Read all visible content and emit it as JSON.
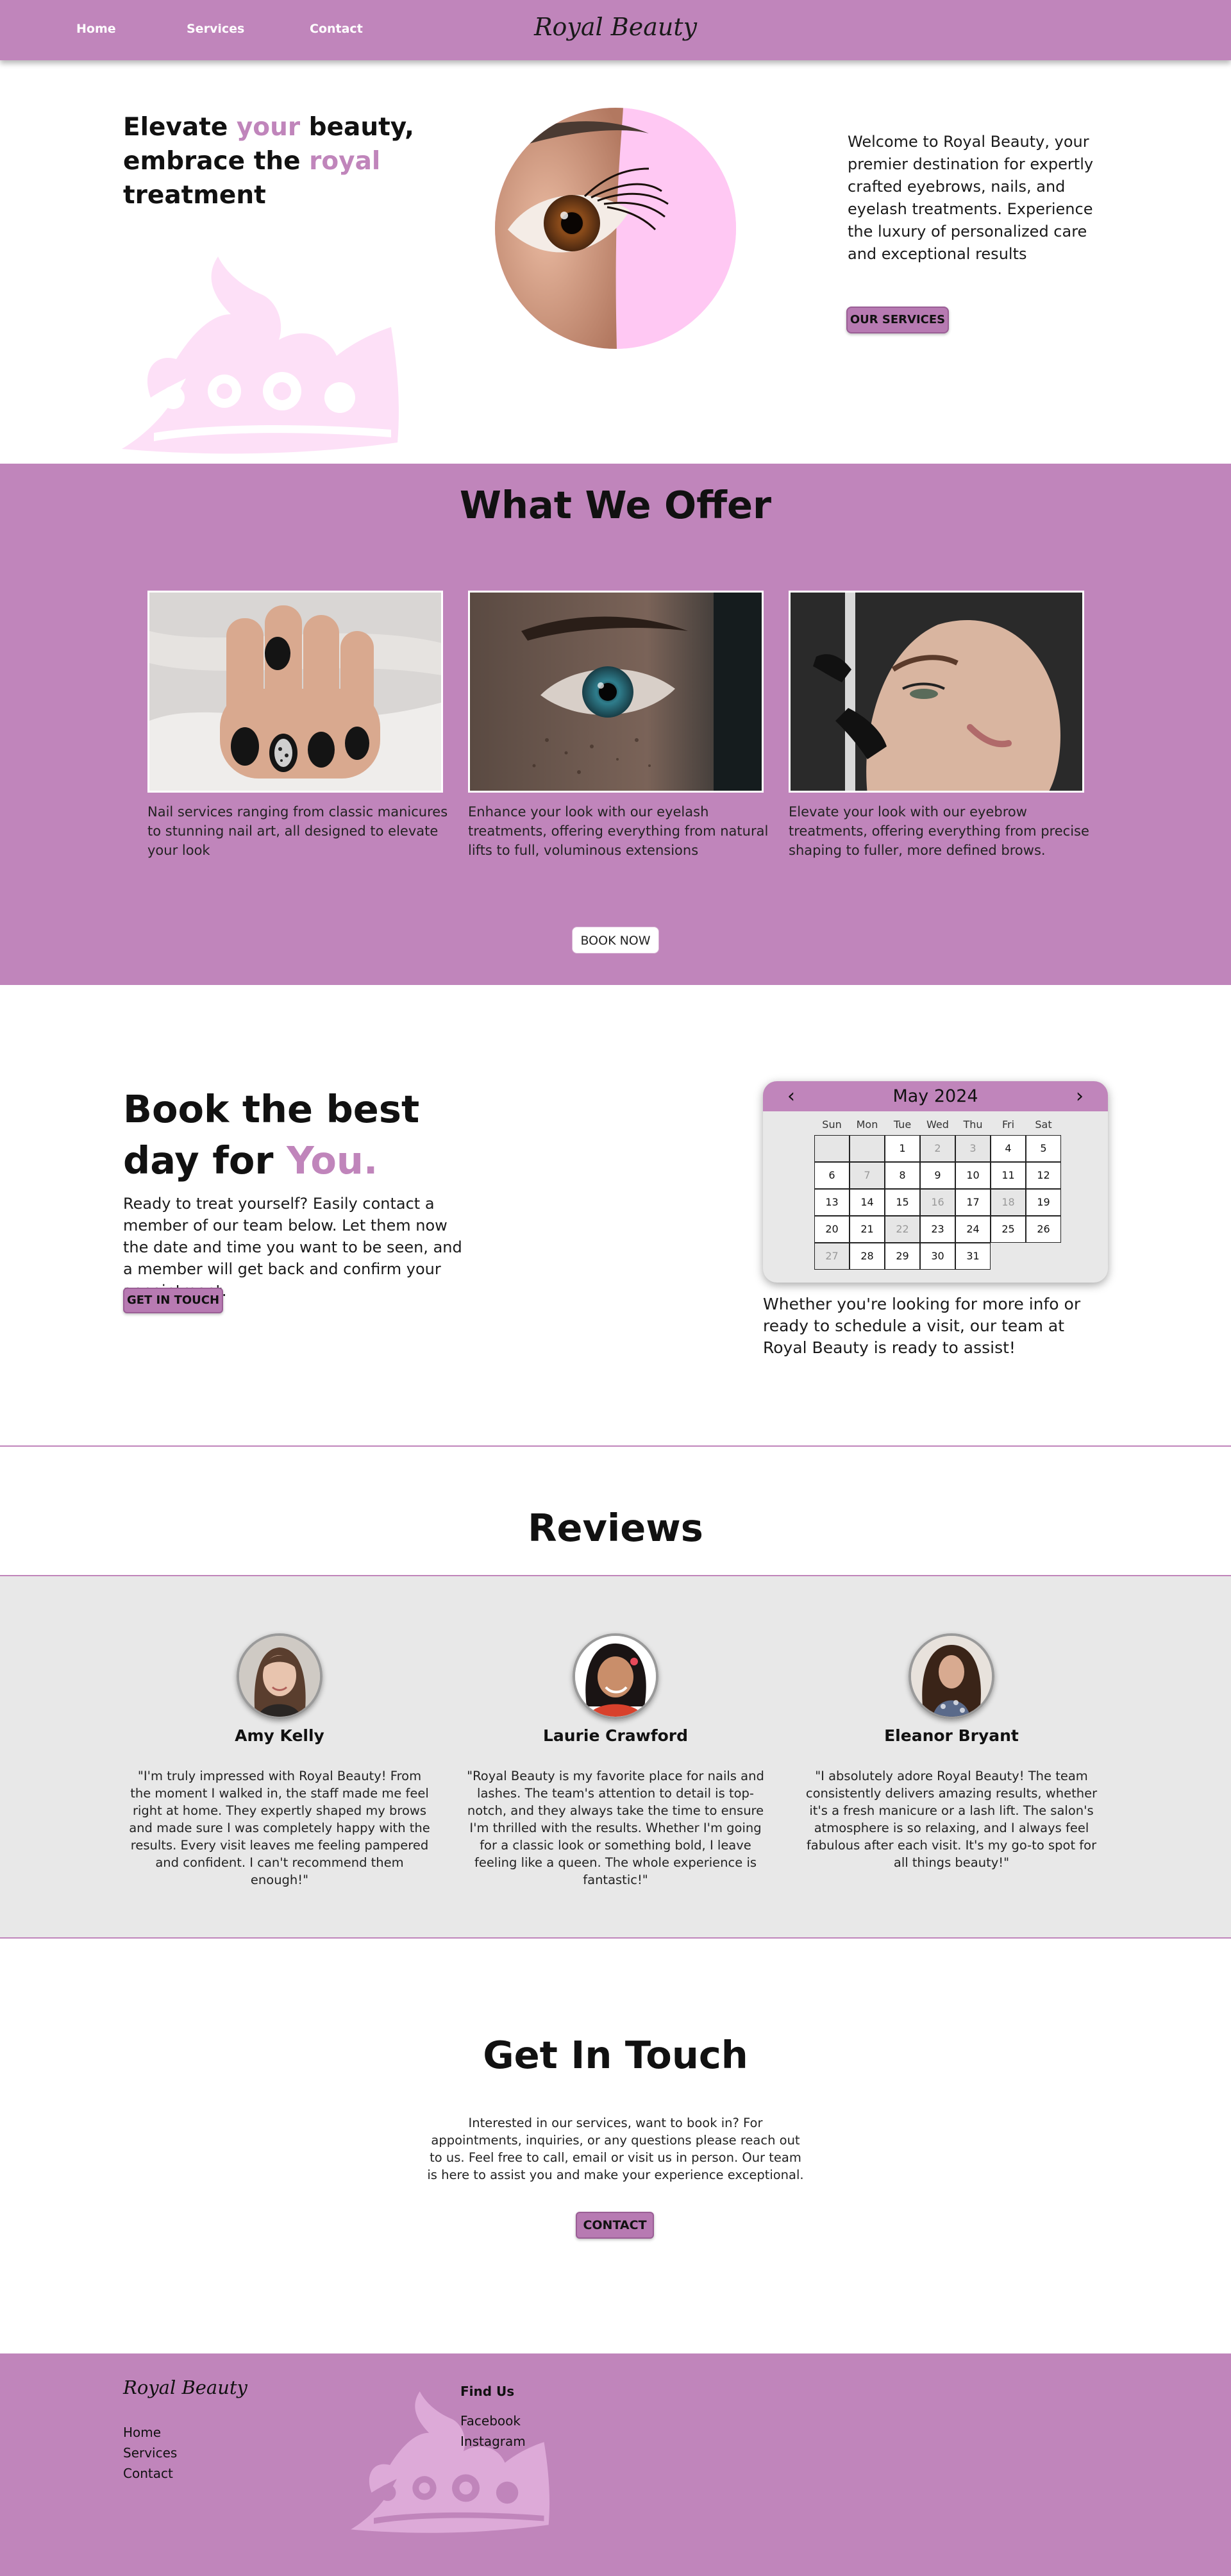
{
  "nav": {
    "links": [
      "Home",
      "Services",
      "Contact"
    ],
    "brand": "Royal Beauty"
  },
  "hero": {
    "title_parts": [
      "Elevate ",
      "your",
      " beauty, embrace the ",
      "royal",
      " treatment"
    ],
    "text": "Welcome to Royal Beauty, your premier destination for expertly crafted eyebrows, nails, and eyelash treatments. Experience the luxury of personalized care and exceptional results",
    "button": "OUR SERVICES"
  },
  "offer": {
    "title": "What We Offer",
    "cards": [
      {
        "text": "Nail services ranging from classic manicures to stunning nail art, all designed to elevate your look"
      },
      {
        "text": "Enhance your look with our eyelash treatments, offering everything from natural lifts to full, voluminous extensions"
      },
      {
        "text": "Elevate your look with our eyebrow treatments, offering everything from precise shaping to fuller, more defined brows."
      }
    ],
    "button": "BOOK NOW"
  },
  "booking": {
    "title_parts": [
      "Book the best day for ",
      "You."
    ],
    "text": "Ready to treat yourself? Easily contact a member of our team below. Let them now the date and time you want to be seen, and a member will get back and confirm your appointment.",
    "button": "GET IN TOUCH",
    "calendar": {
      "month": "May 2024",
      "prev": "‹",
      "next": "›",
      "weekdays": [
        "Sun",
        "Mon",
        "Tue",
        "Wed",
        "Thu",
        "Fri",
        "Sat"
      ],
      "weeks": [
        [
          "",
          "",
          "1",
          "2",
          "3",
          "4",
          "5"
        ],
        [
          "6",
          "7",
          "8",
          "9",
          "10",
          "11",
          "12"
        ],
        [
          "13",
          "14",
          "15",
          "16",
          "17",
          "18",
          "19"
        ],
        [
          "20",
          "21",
          "22",
          "23",
          "24",
          "25",
          "26"
        ],
        [
          "27",
          "28",
          "29",
          "30",
          "31"
        ]
      ],
      "unavailable": [
        "2",
        "3",
        "7",
        "16",
        "18",
        "22",
        "27"
      ]
    },
    "note": "Whether you're looking for more info or ready to schedule a visit, our team at Royal Beauty is ready to assist!"
  },
  "reviews": {
    "title": "Reviews",
    "items": [
      {
        "name": "Amy Kelly",
        "text": "\"I'm truly impressed with Royal Beauty! From the moment I walked in, the staff made me feel right at home. They expertly shaped my brows and made sure I was completely happy with the results. Every visit leaves me feeling pampered and confident. I can't recommend them enough!\""
      },
      {
        "name": "Laurie Crawford",
        "text": "\"Royal Beauty is my favorite place for nails and lashes. The team's attention to detail is top-notch, and they always take the time to ensure I'm thrilled with the results. Whether I'm going for a classic look or something bold, I leave feeling like a queen. The whole experience is fantastic!\""
      },
      {
        "name": "Eleanor Bryant",
        "text": "\"I absolutely adore Royal Beauty! The team consistently delivers amazing results, whether it's a fresh manicure or a lash lift. The salon's atmosphere is so relaxing, and I always feel fabulous after each visit. It's my go-to spot for all things beauty!\""
      }
    ]
  },
  "contact": {
    "title": "Get In Touch",
    "text": "Interested in our services, want to book in? For appointments, inquiries, or any questions please reach out to us. Feel free to call, email or visit us in person. Our team is here to assist you and make your experience exceptional.",
    "button": "CONTACT"
  },
  "footer": {
    "brand": "Royal Beauty",
    "links": [
      "Home",
      "Services",
      "Contact"
    ],
    "find_title": "Find Us",
    "social": [
      "Facebook",
      "Instagram"
    ]
  },
  "colors": {
    "accent": "#c085bb",
    "light_pink": "#ffc8f3",
    "grey_band": "#e8e8e8"
  }
}
